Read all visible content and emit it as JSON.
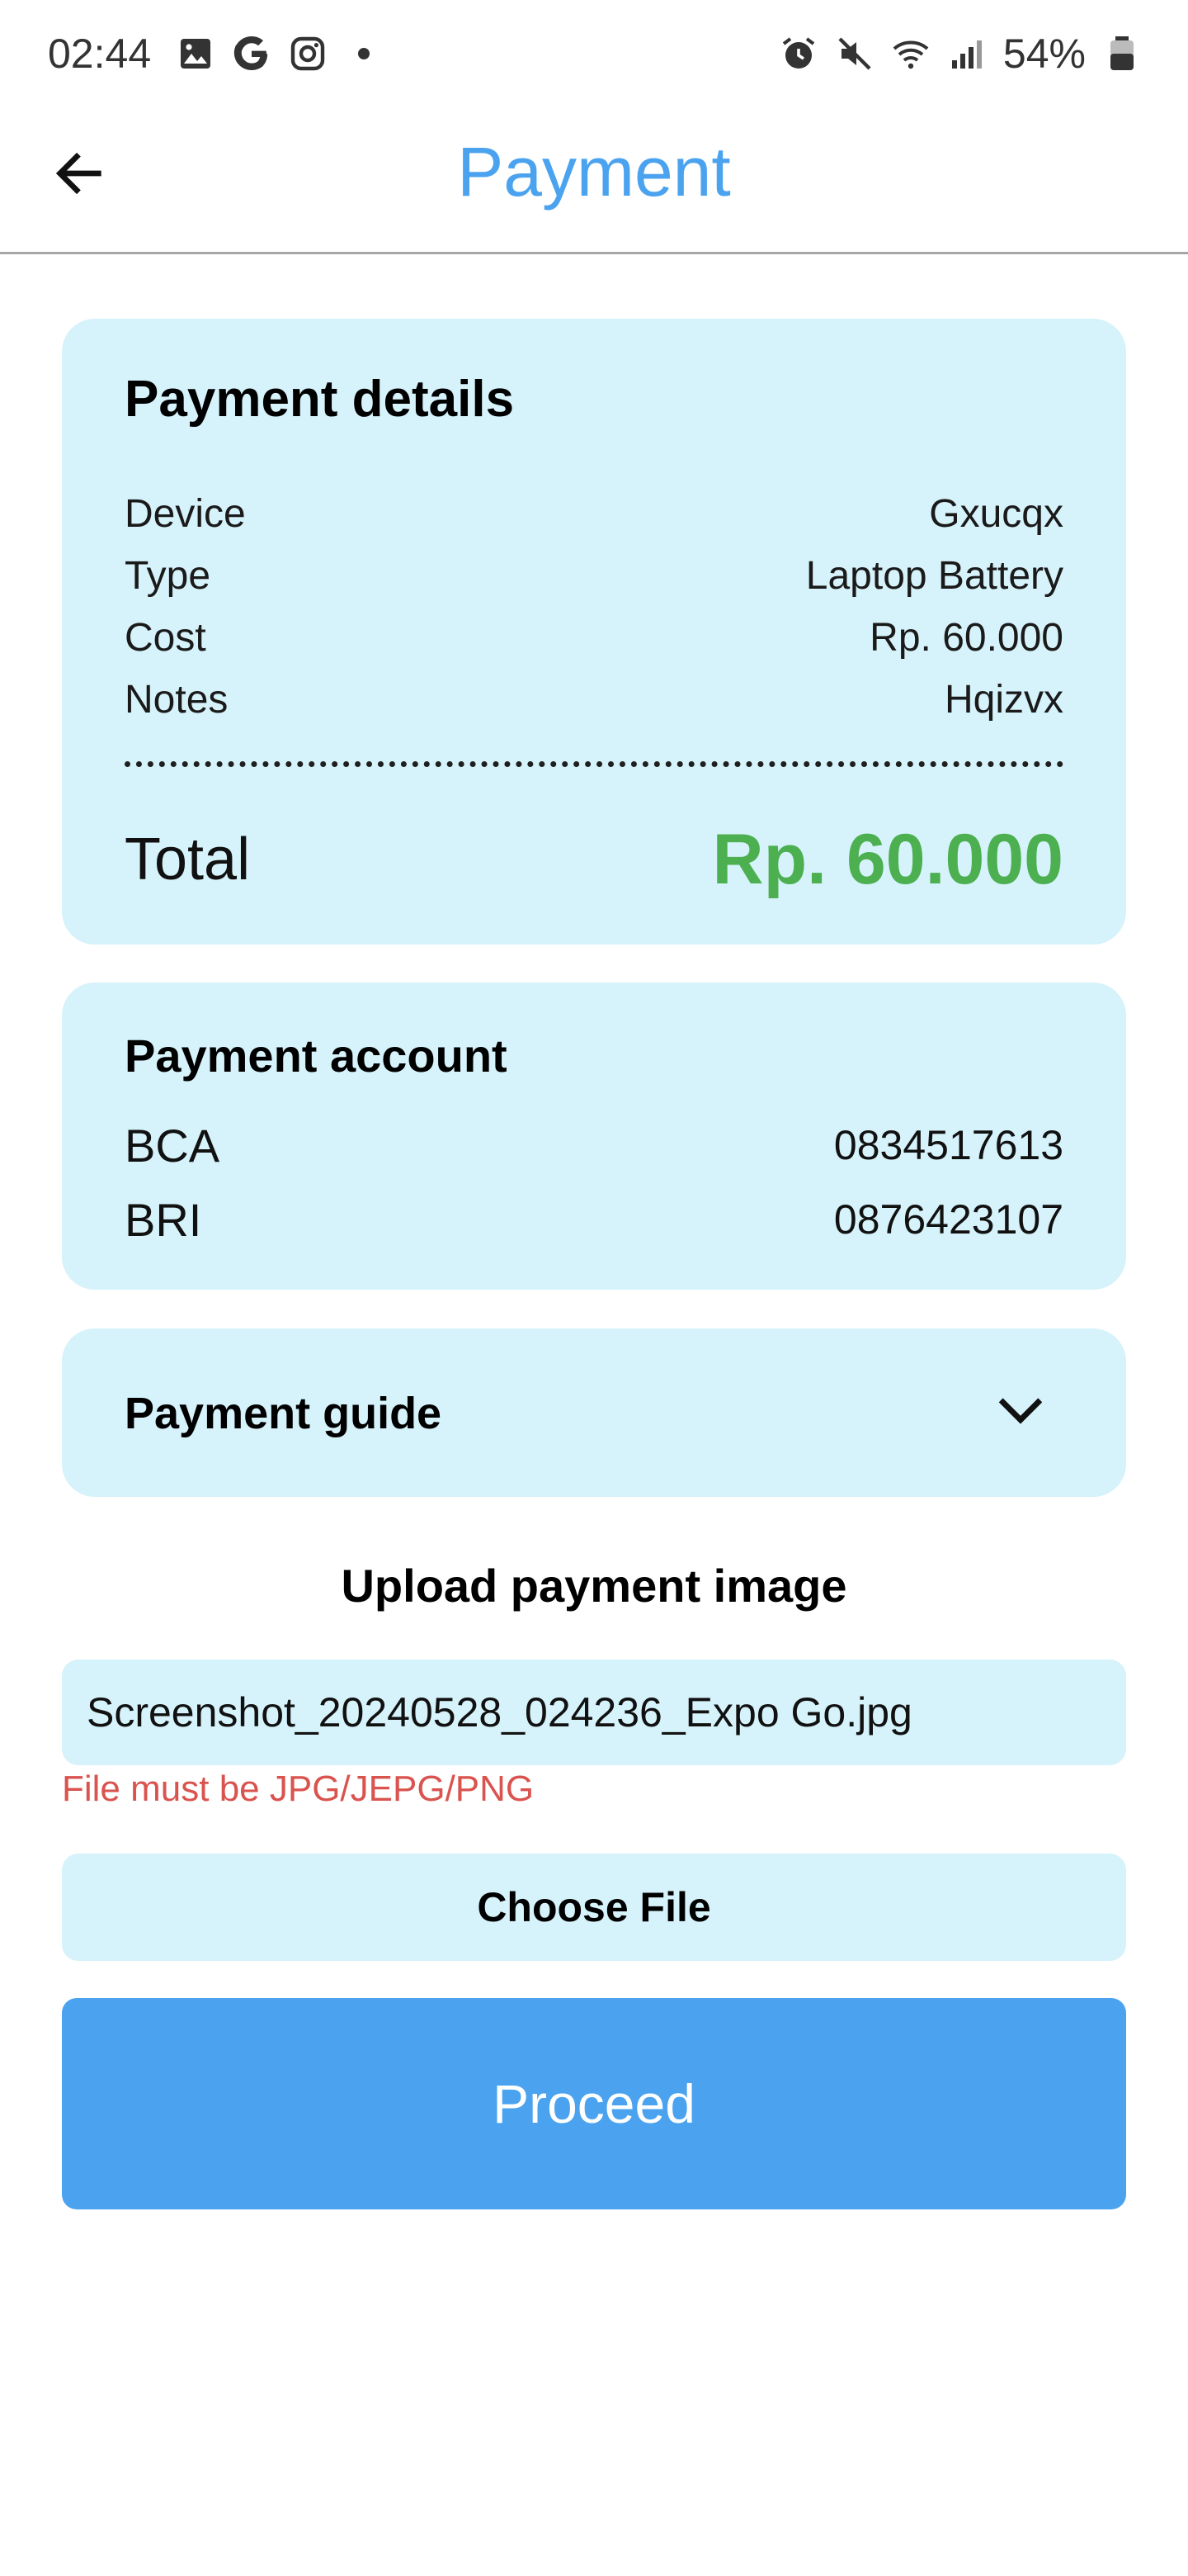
{
  "status_bar": {
    "time": "02:44",
    "left_icons": [
      "image-icon",
      "google-icon",
      "instagram-icon",
      "dot-icon"
    ],
    "right_icons": [
      "alarm-icon",
      "mute-icon",
      "wifi-icon",
      "signal-icon"
    ],
    "battery_percent": "54%"
  },
  "header": {
    "title": "Payment",
    "back_icon": "arrow-left-icon"
  },
  "payment_details": {
    "title": "Payment details",
    "rows": [
      {
        "label": "Device",
        "value": "Gxucqx"
      },
      {
        "label": "Type",
        "value": "Laptop Battery"
      },
      {
        "label": "Cost",
        "value": "Rp. 60.000"
      },
      {
        "label": "Notes",
        "value": "Hqizvx"
      }
    ],
    "total_label": "Total",
    "total_value": "Rp. 60.000"
  },
  "payment_account": {
    "title": "Payment account",
    "accounts": [
      {
        "bank": "BCA",
        "number": "0834517613"
      },
      {
        "bank": "BRI",
        "number": "0876423107"
      }
    ]
  },
  "payment_guide": {
    "title": "Payment guide",
    "expand_icon": "chevron-down-icon"
  },
  "upload": {
    "title": "Upload payment image",
    "file_name": "Screenshot_20240528_024236_Expo Go.jpg",
    "error": "File must be JPG/JEPG/PNG",
    "choose_label": "Choose File"
  },
  "proceed_label": "Proceed",
  "colors": {
    "accent": "#4ba3ef",
    "card_bg": "#d6f2fa",
    "total": "#4caf50",
    "error": "#d9534f"
  }
}
